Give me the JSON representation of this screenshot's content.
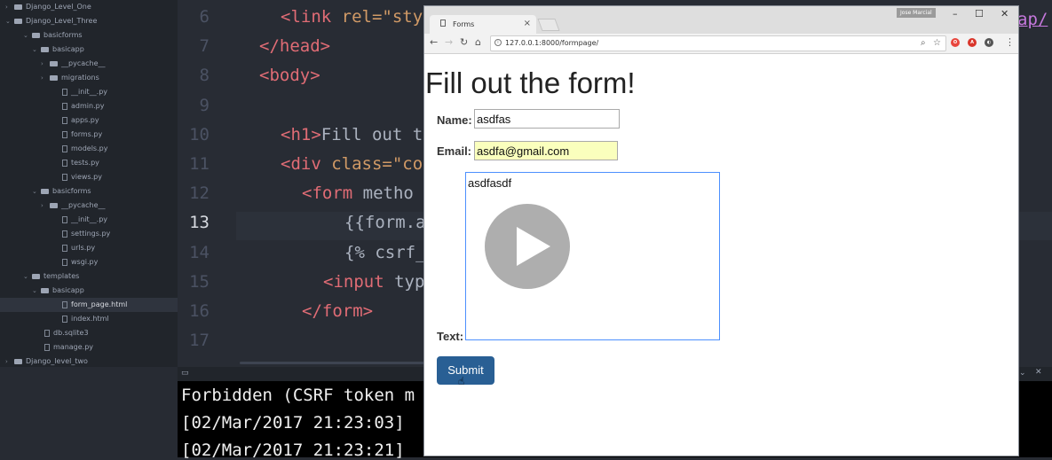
{
  "sidebar": {
    "items": [
      {
        "label": "Django_Level_One",
        "type": "folder",
        "open": false
      },
      {
        "label": "Django_Level_Three",
        "type": "folder",
        "open": true
      },
      {
        "label": "basicforms",
        "type": "folder",
        "open": true
      },
      {
        "label": "basicapp",
        "type": "folder",
        "open": true
      },
      {
        "label": "__pycache__",
        "type": "folder",
        "open": false
      },
      {
        "label": "migrations",
        "type": "folder",
        "open": false
      },
      {
        "label": "__init__.py",
        "type": "file"
      },
      {
        "label": "admin.py",
        "type": "file"
      },
      {
        "label": "apps.py",
        "type": "file"
      },
      {
        "label": "forms.py",
        "type": "file"
      },
      {
        "label": "models.py",
        "type": "file"
      },
      {
        "label": "tests.py",
        "type": "file"
      },
      {
        "label": "views.py",
        "type": "file"
      },
      {
        "label": "basicforms",
        "type": "folder",
        "open": true
      },
      {
        "label": "__pycache__",
        "type": "folder",
        "open": false
      },
      {
        "label": "__init__.py",
        "type": "file"
      },
      {
        "label": "settings.py",
        "type": "file"
      },
      {
        "label": "urls.py",
        "type": "file"
      },
      {
        "label": "wsgi.py",
        "type": "file"
      },
      {
        "label": "templates",
        "type": "folder",
        "open": true
      },
      {
        "label": "basicapp",
        "type": "folder",
        "open": true
      },
      {
        "label": "form_page.html",
        "type": "file",
        "selected": true
      },
      {
        "label": "index.html",
        "type": "file"
      },
      {
        "label": "db.sqlite3",
        "type": "file"
      },
      {
        "label": "manage.py",
        "type": "file"
      },
      {
        "label": "Django_level_two",
        "type": "folder",
        "open": false
      }
    ]
  },
  "editor": {
    "current_line": "13",
    "lines": [
      {
        "n": "6",
        "tag": "<link",
        "rest": " rel=\"sty"
      },
      {
        "n": "7",
        "tag": "</head>",
        "rest": ""
      },
      {
        "n": "8",
        "tag": "<body>",
        "rest": ""
      },
      {
        "n": "9",
        "tag": "",
        "rest": ""
      },
      {
        "n": "10",
        "tag": "<h1>",
        "rest": "Fill out t"
      },
      {
        "n": "11",
        "tag": "<div",
        "rest": " class=\"co"
      },
      {
        "n": "12",
        "tag": "<form",
        "rest": " metho"
      },
      {
        "n": "13",
        "tag": "",
        "rest": "{{form.a"
      },
      {
        "n": "14",
        "tag": "",
        "rest": "{% csrf_"
      },
      {
        "n": "15",
        "tag": "<input",
        "rest": " typ"
      },
      {
        "n": "16",
        "tag": "</form>",
        "rest": ""
      },
      {
        "n": "17",
        "tag": "",
        "rest": ""
      }
    ],
    "edge_text": "ap/"
  },
  "terminal": {
    "lines": [
      "Forbidden (CSRF token m",
      "[02/Mar/2017 21:23:03]",
      "[02/Mar/2017 21:23:21]"
    ]
  },
  "browser": {
    "tab_title": "Forms",
    "user": "Jose Marcial",
    "url": "127.0.0.1:8000/formpage/",
    "page": {
      "heading": "Fill out the form!",
      "name_label": "Name:",
      "name_value": "asdfas",
      "email_label": "Email:",
      "email_value": "asdfa@gmail.com",
      "text_label": "Text:",
      "text_value": "asdfasdf",
      "submit_label": "Submit"
    }
  },
  "colors": {
    "editor_bg": "#282c34",
    "sidebar_bg": "#21252b",
    "tag": "#e06c75",
    "submit_bg": "#295f94",
    "email_autofill_bg": "#faffbd"
  }
}
